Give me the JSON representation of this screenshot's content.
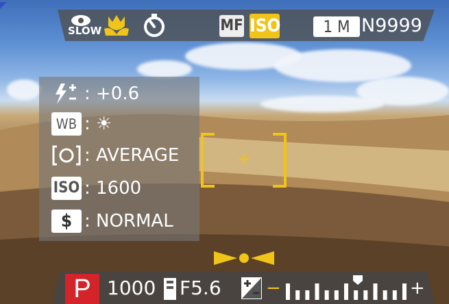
{
  "top_bar": {
    "slow_icon_text": "SLOW",
    "macro_icon": "tulip-macro-icon",
    "self_timer_icon": "self-timer-icon",
    "mf_label": "MF",
    "iso_label": "ISO",
    "size_label": "1 M",
    "frames_remaining": "N9999"
  },
  "panel": {
    "exposure_comp": {
      "icon": "flash-exposure-icon",
      "value": ": +0.6"
    },
    "white_balance": {
      "icon_text": "WB",
      "value": ": ☀"
    },
    "metering": {
      "icon_text": "[O]",
      "value": ": AVERAGE"
    },
    "iso": {
      "icon_text": "ISO",
      "value": ": 1600"
    },
    "quality": {
      "icon_text": "$",
      "value": ": NORMAL"
    }
  },
  "focus": {
    "center_mark": "+"
  },
  "bottom_bar": {
    "mode": "P",
    "shutter": "1000",
    "aperture": "F5.6",
    "ev_minus": "−",
    "ev_plus": "+",
    "ev_level": 0.2
  },
  "colors": {
    "accent_yellow": "#f0c419",
    "mode_red": "#d3242a"
  }
}
